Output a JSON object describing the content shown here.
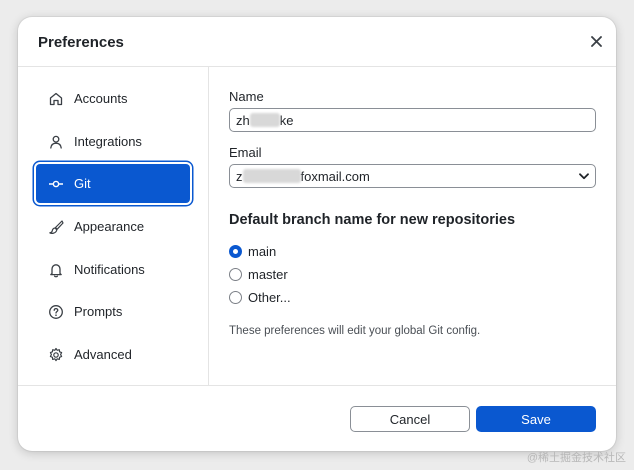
{
  "dialog": {
    "title": "Preferences",
    "close_icon": "close-icon"
  },
  "sidebar": {
    "items": [
      {
        "label": "Accounts",
        "icon": "home-icon",
        "active": false
      },
      {
        "label": "Integrations",
        "icon": "user-icon",
        "active": false
      },
      {
        "label": "Git",
        "icon": "git-commit-icon",
        "active": true
      },
      {
        "label": "Appearance",
        "icon": "brush-icon",
        "active": false
      },
      {
        "label": "Notifications",
        "icon": "bell-icon",
        "active": false
      },
      {
        "label": "Prompts",
        "icon": "question-icon",
        "active": false
      },
      {
        "label": "Advanced",
        "icon": "gear-icon",
        "active": false
      }
    ]
  },
  "git": {
    "name_label": "Name",
    "name_value_prefix": "zh",
    "name_value_suffix": "ke",
    "email_label": "Email",
    "email_value_prefix": "z",
    "email_value_suffix": "foxmail.com",
    "branch_section_title": "Default branch name for new repositories",
    "branch_options": [
      {
        "label": "main",
        "checked": true
      },
      {
        "label": "master",
        "checked": false
      },
      {
        "label": "Other...",
        "checked": false
      }
    ],
    "hint": "These preferences will edit your global Git config."
  },
  "footer": {
    "cancel_label": "Cancel",
    "save_label": "Save"
  },
  "watermark": "@稀土掘金技术社区",
  "colors": {
    "accent": "#0a58d0",
    "border": "#8a8f96",
    "divider": "#e4e4e4"
  }
}
